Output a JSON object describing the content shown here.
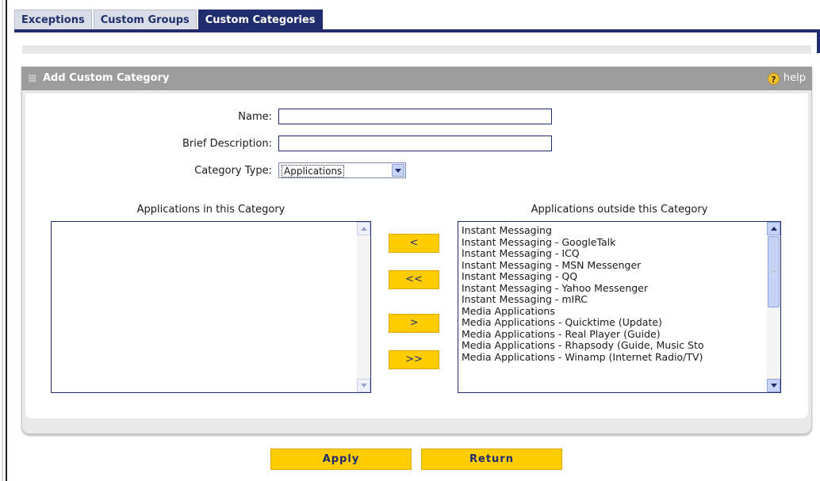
{
  "tabs": [
    {
      "label": "Exceptions",
      "active": false
    },
    {
      "label": "Custom Groups",
      "active": false
    },
    {
      "label": "Custom Categories",
      "active": true
    }
  ],
  "panel": {
    "title": "Add Custom Category",
    "help_label": "help"
  },
  "form": {
    "name_label": "Name:",
    "name_value": "",
    "description_label": "Brief Description:",
    "description_value": "",
    "category_type_label": "Category Type:",
    "category_type_value": "Applications"
  },
  "lists": {
    "inside_title": "Applications in this Category",
    "inside_items": [],
    "outside_title": "Applications outside this Category",
    "outside_items": [
      "Instant Messaging",
      "Instant Messaging - GoogleTalk",
      "Instant Messaging - ICQ",
      "Instant Messaging - MSN Messenger",
      "Instant Messaging - QQ",
      "Instant Messaging - Yahoo Messenger",
      "Instant Messaging - mIRC",
      "Media Applications",
      "Media Applications - Quicktime (Update)",
      "Media Applications - Real Player (Guide)",
      "Media Applications - Rhapsody (Guide, Music Sto",
      "Media Applications - Winamp (Internet Radio/TV)"
    ]
  },
  "move_buttons": {
    "add_one": "<",
    "add_all": "<<",
    "remove_one": ">",
    "remove_all": ">>"
  },
  "actions": {
    "apply_label": "Apply",
    "return_label": "Return"
  },
  "colors": {
    "accent": "#1f2d6e",
    "button": "#ffcc00",
    "panel_header": "#9c9c9c"
  }
}
